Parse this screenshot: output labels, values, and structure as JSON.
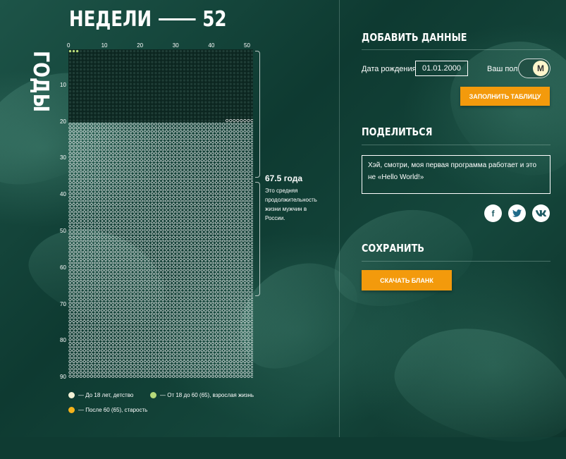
{
  "header": {
    "weeks_label": "НЕДЕЛИ",
    "weeks_total": "52",
    "years_label": "ГОДЫ"
  },
  "axis": {
    "x_ticks": [
      "0",
      "10",
      "20",
      "30",
      "40",
      "50"
    ],
    "y_ticks": [
      "10",
      "20",
      "30",
      "40",
      "50",
      "60",
      "70",
      "80",
      "90"
    ]
  },
  "grid": {
    "weeks_per_year": 52,
    "years": 90,
    "dark_years": 20,
    "filled_in_last_dark_row": 44,
    "highlight_cells": 3,
    "colors": {
      "dark_block": "#0c2620",
      "dark_cell": "#1f3d36",
      "cell_outline": "#ffffff",
      "highlight": "#b6d97a"
    }
  },
  "life_expectancy": {
    "value": "67.5 года",
    "text": "Это средняя продолжительность жизни мужчин в России."
  },
  "legend": [
    {
      "label": "— До 18 лет, детство",
      "color": "#f3f2d6"
    },
    {
      "label": "— От 18 до 60 (65), взрослая жизнь",
      "color": "#b6d97a"
    },
    {
      "label": "— После 60 (65), старость",
      "color": "#f5b21b"
    }
  ],
  "add_data": {
    "title": "ДОБАВИТЬ ДАННЫЕ",
    "dob_label": "Дата рождения",
    "dob_value": "01.01.2000",
    "sex_label": "Ваш пол",
    "sex_value": "М",
    "fill_button": "ЗАПОЛНИТЬ ТАБЛИЦУ"
  },
  "share": {
    "title": "ПОДЕЛИТЬСЯ",
    "message": "Хэй, смотри, моя первая программа работает и это не «Hello World!»",
    "social_icons": [
      "facebook-icon",
      "twitter-icon",
      "vk-icon"
    ]
  },
  "save": {
    "title": "СОХРАНИТЬ",
    "download_button": "СКАЧАТЬ БЛАНК"
  },
  "accent_color": "#f39a0c"
}
